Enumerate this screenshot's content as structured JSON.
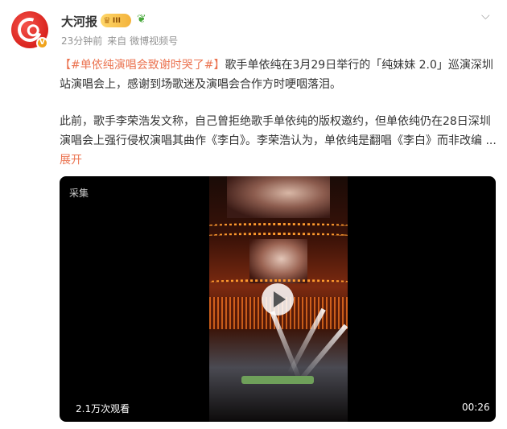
{
  "post": {
    "author": "大河报",
    "badge_level": "III",
    "time": "23分钟前",
    "source": "来自 微博视频号",
    "topic": "【#单依纯演唱会致谢时哭了#】",
    "paragraph1": "歌手单依纯在3月29日举行的「纯妹妹 2.0」巡演深圳站演唱会上，感谢到场歌迷及演唱会合作方时哽咽落泪。",
    "paragraph2": "此前，歌手李荣浩发文称，自己曾拒绝歌手单依纯的版权邀约，但单依纯仍在28日深圳演唱会上强行侵权演唱其曲作《李白》。李荣浩认为，单依纯是翻唱《李白》而非改编",
    "ellipsis": " ... ",
    "expand": "展开"
  },
  "video": {
    "source_label": "采集",
    "views": "2.1万次观看",
    "duration": "00:26"
  },
  "icons": {
    "crown": "crown-icon",
    "sprout": "sprout-icon",
    "more": "chevron-down-icon",
    "play": "play-icon"
  },
  "colors": {
    "accent": "#eb7350",
    "brand_red": "#d9231d",
    "meta_gray": "#939393"
  }
}
